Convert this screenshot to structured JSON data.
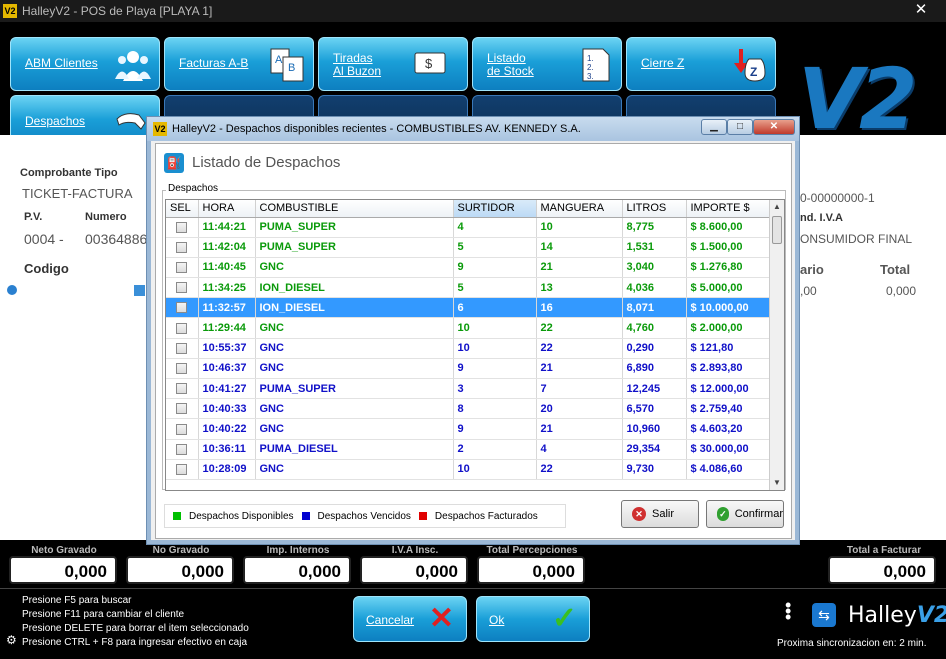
{
  "window": {
    "app_logo": "V2",
    "title": "HalleyV2 - POS de Playa [PLAYA 1]",
    "close": "✕"
  },
  "tiles": [
    {
      "label1": "ABM Clientes",
      "label2": "",
      "icon": "users-icon"
    },
    {
      "label1": "Facturas A-B",
      "label2": "",
      "icon": "invoice-ab-icon"
    },
    {
      "label1": "Tiradas",
      "label2": "Al Buzon",
      "icon": "cash-bills-icon"
    },
    {
      "label1": "Listado",
      "label2": "de Stock",
      "icon": "numbered-list-icon"
    },
    {
      "label1": "Cierre Z",
      "label2": "",
      "icon": "money-bag-icon"
    },
    {
      "label1": "Despachos",
      "label2": "",
      "icon": "fuel-nozzle-icon"
    }
  ],
  "logo": "V2",
  "form": {
    "comprobante_tipo_label": "Comprobante Tipo",
    "comprobante_tipo_value": "TICKET-FACTURA",
    "pv_label": "P.V.",
    "pv_value": "0004 -",
    "numero_label": "Numero",
    "numero_value": "00364886",
    "codigo_label": "Codigo",
    "right_number": "0-00000000-1",
    "cond_iva_label": "nd. I.V.A",
    "cond_iva_value": "ONSUMIDOR FINAL",
    "unitario_label": "ario",
    "total_label": "Total",
    "unitario_value": ",00",
    "total_value": "0,000"
  },
  "totals": [
    {
      "label": "Neto Gravado",
      "value": "0,000"
    },
    {
      "label": "No Gravado",
      "value": "0,000"
    },
    {
      "label": "Imp. Internos",
      "value": "0,000"
    },
    {
      "label": "I.V.A Insc.",
      "value": "0,000"
    },
    {
      "label": "Total Percepciones",
      "value": "0,000"
    },
    {
      "label": "Total a Facturar",
      "value": "0,000"
    }
  ],
  "hints": [
    "Presione F5 para buscar",
    "Presione F11 para cambiar el cliente",
    "Presione DELETE para borrar el item seleccionado",
    "Presione CTRL + F8 para ingresar efectivo en caja"
  ],
  "buttons": {
    "cancel_label": "Cancelar",
    "cancel_mark": "✕",
    "ok_label": "Ok",
    "ok_mark": "✓"
  },
  "brand": {
    "name": "Halley",
    "v2": "V2",
    "tv": "⇆"
  },
  "sync_text": "Proxima sincronizacion en: 2 min.",
  "dialog": {
    "app_logo": "V2",
    "title": "HalleyV2 - Despachos disponibles recientes - COMBUSTIBLES AV. KENNEDY S.A.",
    "header_title": "Listado de Despachos",
    "group_label": "Despachos",
    "columns": [
      "SEL",
      "HORA",
      "COMBUSTIBLE",
      "SURTIDOR",
      "MANGUERA",
      "LITROS",
      "IMPORTE $"
    ],
    "rows": [
      {
        "hora": "11:44:21",
        "combustible": "PUMA_SUPER",
        "surtidor": "4",
        "manguera": "10",
        "litros": "8,775",
        "importe": "$ 8.600,00",
        "status": "green"
      },
      {
        "hora": "11:42:04",
        "combustible": "PUMA_SUPER",
        "surtidor": "5",
        "manguera": "14",
        "litros": "1,531",
        "importe": "$ 1.500,00",
        "status": "green"
      },
      {
        "hora": "11:40:45",
        "combustible": "GNC",
        "surtidor": "9",
        "manguera": "21",
        "litros": "3,040",
        "importe": "$ 1.276,80",
        "status": "green"
      },
      {
        "hora": "11:34:25",
        "combustible": "ION_DIESEL",
        "surtidor": "5",
        "manguera": "13",
        "litros": "4,036",
        "importe": "$ 5.000,00",
        "status": "green"
      },
      {
        "hora": "11:32:57",
        "combustible": "ION_DIESEL",
        "surtidor": "6",
        "manguera": "16",
        "litros": "8,071",
        "importe": "$ 10.000,00",
        "status": "selected"
      },
      {
        "hora": "11:29:44",
        "combustible": "GNC",
        "surtidor": "10",
        "manguera": "22",
        "litros": "4,760",
        "importe": "$ 2.000,00",
        "status": "green"
      },
      {
        "hora": "10:55:37",
        "combustible": "GNC",
        "surtidor": "10",
        "manguera": "22",
        "litros": "0,290",
        "importe": "$ 121,80",
        "status": "blue"
      },
      {
        "hora": "10:46:37",
        "combustible": "GNC",
        "surtidor": "9",
        "manguera": "21",
        "litros": "6,890",
        "importe": "$ 2.893,80",
        "status": "blue"
      },
      {
        "hora": "10:41:27",
        "combustible": "PUMA_SUPER",
        "surtidor": "3",
        "manguera": "7",
        "litros": "12,245",
        "importe": "$ 12.000,00",
        "status": "blue"
      },
      {
        "hora": "10:40:33",
        "combustible": "GNC",
        "surtidor": "8",
        "manguera": "20",
        "litros": "6,570",
        "importe": "$ 2.759,40",
        "status": "blue"
      },
      {
        "hora": "10:40:22",
        "combustible": "GNC",
        "surtidor": "9",
        "manguera": "21",
        "litros": "10,960",
        "importe": "$ 4.603,20",
        "status": "blue"
      },
      {
        "hora": "10:36:11",
        "combustible": "PUMA_DIESEL",
        "surtidor": "2",
        "manguera": "4",
        "litros": "29,354",
        "importe": "$ 30.000,00",
        "status": "blue"
      },
      {
        "hora": "10:28:09",
        "combustible": "GNC",
        "surtidor": "10",
        "manguera": "22",
        "litros": "9,730",
        "importe": "$ 4.086,60",
        "status": "blue"
      }
    ],
    "legend": [
      {
        "label": "Despachos Disponibles",
        "color": "#00c000"
      },
      {
        "label": "Despachos Vencidos",
        "color": "#0000d0"
      },
      {
        "label": "Despachos Facturados",
        "color": "#e00000"
      }
    ],
    "salir_label": "Salir",
    "confirmar_label": "Confirmar"
  }
}
